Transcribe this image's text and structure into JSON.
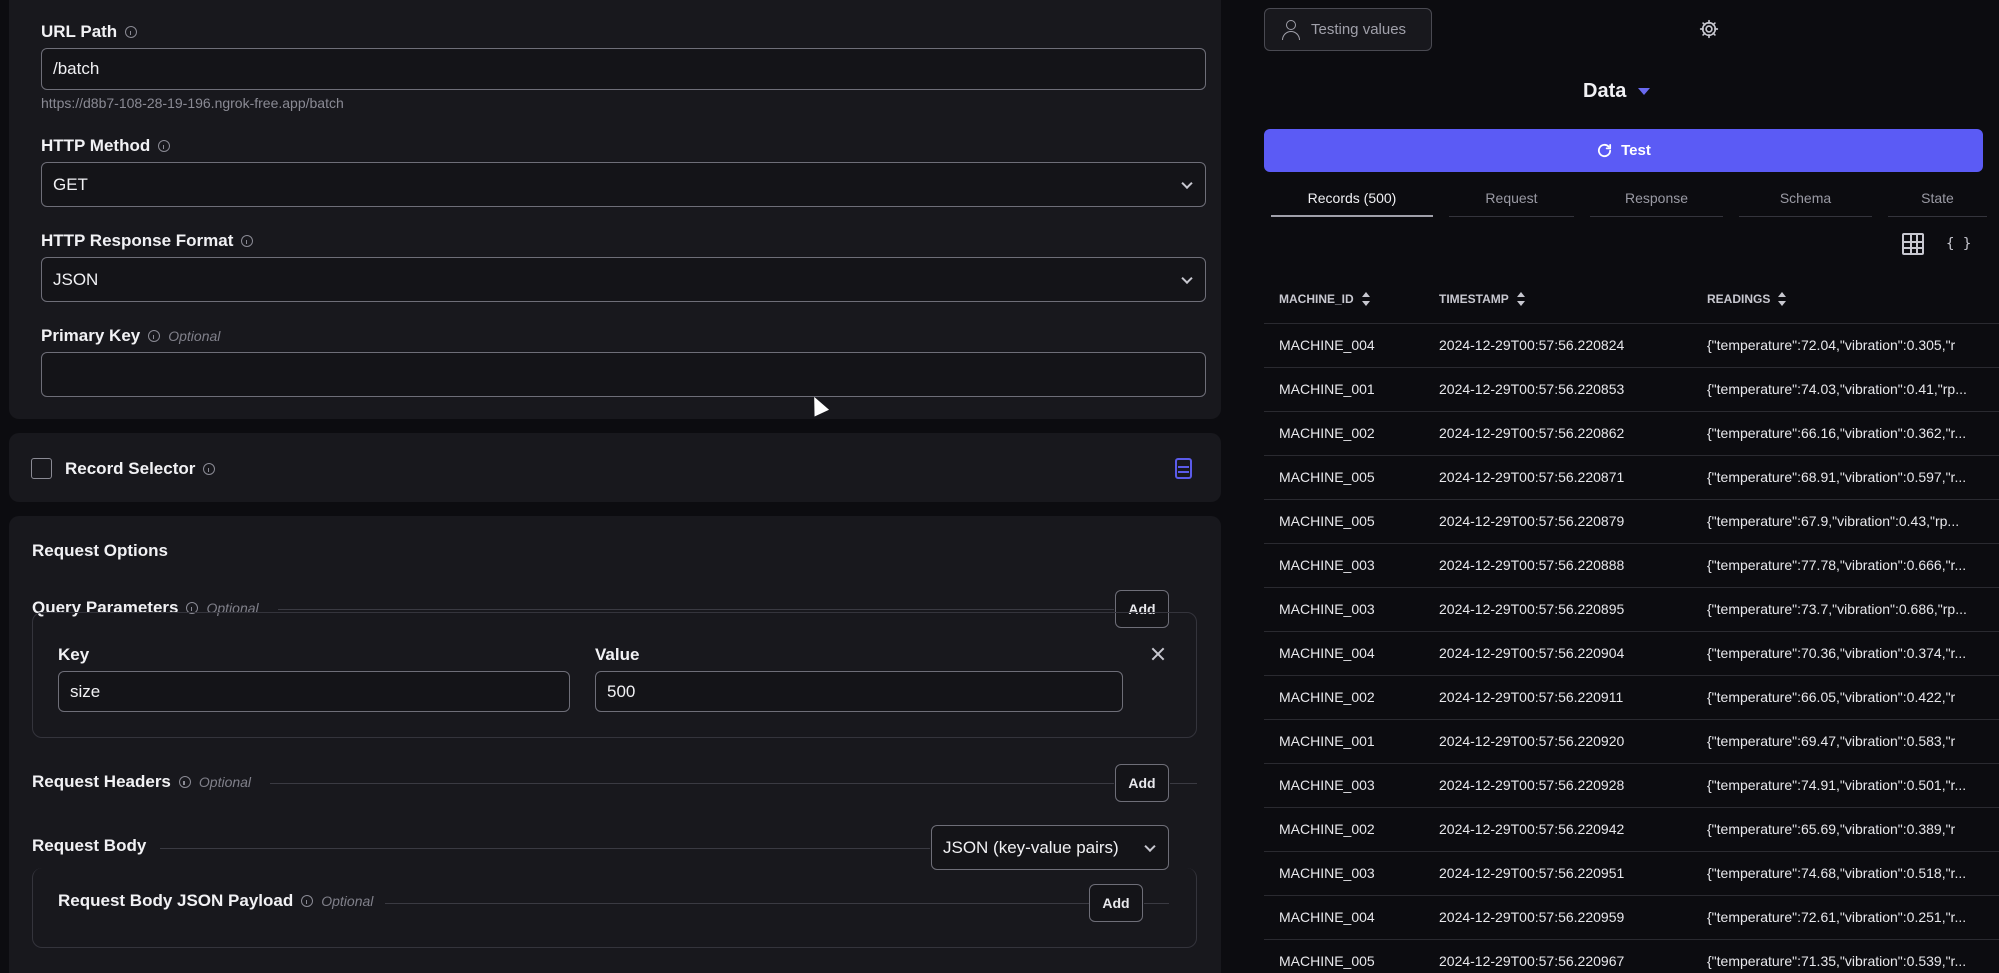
{
  "form": {
    "url_path": {
      "label": "URL Path",
      "value": "/batch",
      "hint": "https://d8b7-108-28-19-196.ngrok-free.app/batch"
    },
    "http_method": {
      "label": "HTTP Method",
      "value": "GET"
    },
    "response_format": {
      "label": "HTTP Response Format",
      "value": "JSON"
    },
    "primary_key": {
      "label": "Primary Key",
      "optional": "Optional",
      "value": ""
    },
    "record_selector": {
      "label": "Record Selector"
    },
    "request_options": {
      "title": "Request Options",
      "query_parameters": {
        "label": "Query Parameters",
        "optional": "Optional",
        "add_label": "Add",
        "key_label": "Key",
        "value_label": "Value",
        "key": "size",
        "value": "500"
      },
      "request_headers": {
        "label": "Request Headers",
        "optional": "Optional",
        "add_label": "Add"
      },
      "request_body": {
        "label": "Request Body",
        "type_value": "JSON (key-value pairs)",
        "payload_label": "Request Body JSON Payload",
        "payload_optional": "Optional",
        "add_label": "Add"
      }
    }
  },
  "panel": {
    "testing_values_label": "Testing values",
    "data_title": "Data",
    "test_button": "Test",
    "tabs": [
      "Records (500)",
      "Request",
      "Response",
      "Schema",
      "State"
    ],
    "active_tab": "Records (500)",
    "columns": [
      "MACHINE_ID",
      "TIMESTAMP",
      "READINGS"
    ],
    "rows": [
      [
        "MACHINE_004",
        "2024-12-29T00:57:56.220824",
        "{\"temperature\":72.04,\"vibration\":0.305,\"r"
      ],
      [
        "MACHINE_001",
        "2024-12-29T00:57:56.220853",
        "{\"temperature\":74.03,\"vibration\":0.41,\"rp..."
      ],
      [
        "MACHINE_002",
        "2024-12-29T00:57:56.220862",
        "{\"temperature\":66.16,\"vibration\":0.362,\"r..."
      ],
      [
        "MACHINE_005",
        "2024-12-29T00:57:56.220871",
        "{\"temperature\":68.91,\"vibration\":0.597,\"r..."
      ],
      [
        "MACHINE_005",
        "2024-12-29T00:57:56.220879",
        "{\"temperature\":67.9,\"vibration\":0.43,\"rp..."
      ],
      [
        "MACHINE_003",
        "2024-12-29T00:57:56.220888",
        "{\"temperature\":77.78,\"vibration\":0.666,\"r..."
      ],
      [
        "MACHINE_003",
        "2024-12-29T00:57:56.220895",
        "{\"temperature\":73.7,\"vibration\":0.686,\"rp..."
      ],
      [
        "MACHINE_004",
        "2024-12-29T00:57:56.220904",
        "{\"temperature\":70.36,\"vibration\":0.374,\"r..."
      ],
      [
        "MACHINE_002",
        "2024-12-29T00:57:56.220911",
        "{\"temperature\":66.05,\"vibration\":0.422,\"r"
      ],
      [
        "MACHINE_001",
        "2024-12-29T00:57:56.220920",
        "{\"temperature\":69.47,\"vibration\":0.583,\"r"
      ],
      [
        "MACHINE_003",
        "2024-12-29T00:57:56.220928",
        "{\"temperature\":74.91,\"vibration\":0.501,\"r..."
      ],
      [
        "MACHINE_002",
        "2024-12-29T00:57:56.220942",
        "{\"temperature\":65.69,\"vibration\":0.389,\"r"
      ],
      [
        "MACHINE_003",
        "2024-12-29T00:57:56.220951",
        "{\"temperature\":74.68,\"vibration\":0.518,\"r..."
      ],
      [
        "MACHINE_004",
        "2024-12-29T00:57:56.220959",
        "{\"temperature\":72.61,\"vibration\":0.251,\"r..."
      ],
      [
        "MACHINE_005",
        "2024-12-29T00:57:56.220967",
        "{\"temperature\":71.35,\"vibration\":0.539,\"r..."
      ]
    ]
  },
  "colors": {
    "accent": "#5b5bf5",
    "background": "#0c0c10",
    "card": "#18181d"
  }
}
